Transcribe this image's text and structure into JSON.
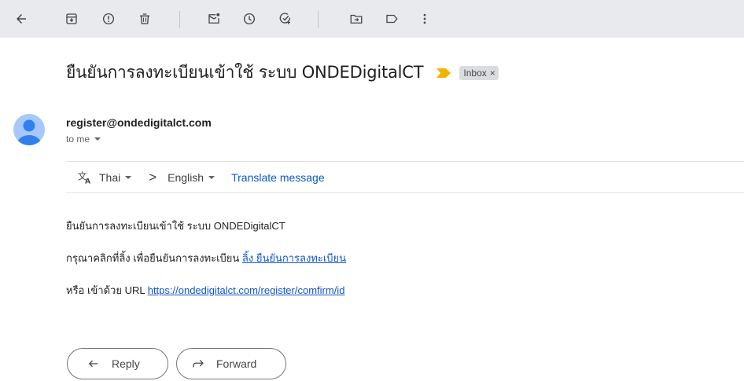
{
  "toolbar": {
    "icons": [
      "back-arrow-icon",
      "archive-icon",
      "report-spam-icon",
      "delete-icon",
      "mark-unread-icon",
      "snooze-icon",
      "add-to-tasks-icon",
      "move-to-icon",
      "label-icon",
      "more-options-icon"
    ]
  },
  "email": {
    "subject": "ยืนยันการลงทะเบียนเข้าใช้ ระบบ ONDEDigitalCT",
    "label_chip": "Inbox",
    "label_chip_close": "×",
    "sender": "register@ondedigitalct.com",
    "recipients": "to me",
    "translate": {
      "from_lang": "Thai",
      "arrow": ">",
      "to_lang": "English",
      "action": "Translate message"
    },
    "body": {
      "line1": "ยืนยันการลงทะเบียนเข้าใช้ ระบบ ONDEDigitalCT",
      "line2_prefix": "กรุณาคลิกที่ลิ้ง เพื่อยืนยันการลงทะเบียน ",
      "line2_link": "ลิ้ง ยืนยันการลงทะเบียน",
      "line3_prefix": "หรือ เข้าด้วย URL ",
      "line3_link": "https://ondedigitalct.com/register/comfirm/id"
    }
  },
  "actions": {
    "reply": "Reply",
    "forward": "Forward"
  },
  "colors": {
    "toolbar_bg": "#e8eaed",
    "important_marker": "#f2b400",
    "link": "#1155cc",
    "translate_link": "#0b57d0",
    "avatar": "#a8c7fa"
  }
}
